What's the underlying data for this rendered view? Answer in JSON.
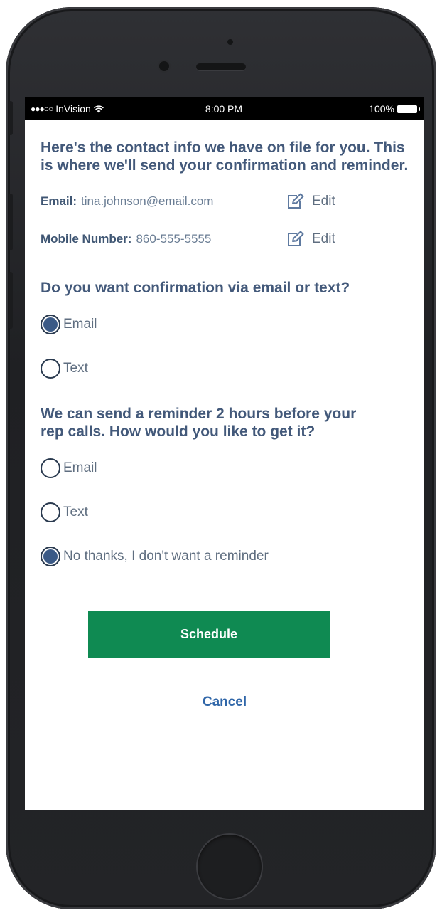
{
  "status_bar": {
    "carrier": "InVision",
    "signal_dots": "●●●○○",
    "time": "8:00 PM",
    "battery": "100%",
    "wifi_icon": "wifi-icon",
    "battery_icon": "battery-icon"
  },
  "intro": "Here's the contact info we have on file for you. This is where we'll send your confirmation and reminder.",
  "contact": {
    "email_label": "Email:",
    "email_value": "tina.johnson@email.com",
    "mobile_label": "Mobile Number:",
    "mobile_value": "860-555-5555",
    "edit_label": "Edit",
    "edit_icon": "pencil-square-icon"
  },
  "confirmation": {
    "question": "Do you want confirmation via email or text?",
    "options": [
      {
        "label": "Email",
        "checked": true
      },
      {
        "label": "Text",
        "checked": false
      }
    ]
  },
  "reminder": {
    "question": "We can send a reminder 2 hours before your rep calls. How would you like to get it?",
    "options": [
      {
        "label": "Email",
        "checked": false
      },
      {
        "label": "Text",
        "checked": false
      },
      {
        "label": "No thanks, I don't want a reminder",
        "checked": true
      }
    ]
  },
  "actions": {
    "schedule_label": "Schedule",
    "cancel_label": "Cancel"
  },
  "colors": {
    "primary_button": "#0f8a52",
    "link": "#2f66a8",
    "heading_text": "#43597a",
    "radio_fill": "#3b5a86"
  }
}
